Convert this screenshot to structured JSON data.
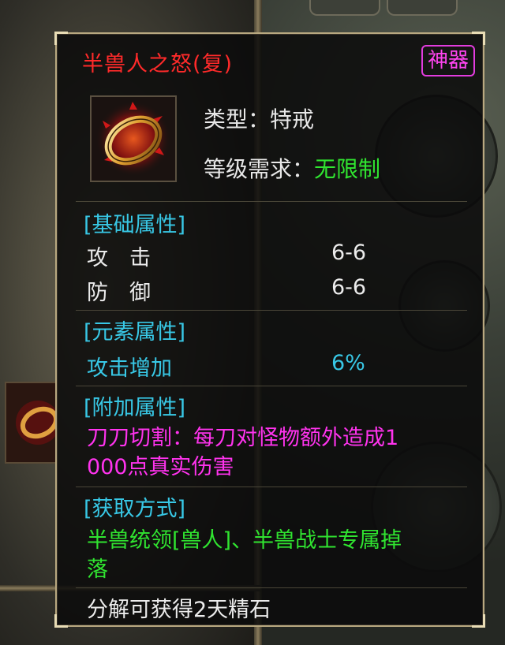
{
  "item": {
    "name": "半兽人之怒(复)",
    "badge": "神器",
    "icon": "ring-icon",
    "type_line": "类型：特戒",
    "level_label": "等级需求：",
    "level_value": "无限制"
  },
  "sections": {
    "basic": {
      "title": "[基础属性]",
      "stats": [
        {
          "label": "攻　击",
          "value": "6-6"
        },
        {
          "label": "防　御",
          "value": "6-6"
        }
      ]
    },
    "element": {
      "title": "[元素属性]",
      "stats": [
        {
          "label": "攻击增加",
          "value": "6%"
        }
      ]
    },
    "extra": {
      "title": "[附加属性]",
      "text_line1": "刀刀切割：每刀对怪物额外造成1",
      "text_line2": "000点真实伤害"
    },
    "source": {
      "title": "[获取方式]",
      "text_line1": "半兽统领[兽人]、半兽战士专属掉",
      "text_line2": "落"
    }
  },
  "footer": "分解可获得2天精石",
  "colors": {
    "name": "#ff2a2a",
    "badge": "#ff44f0",
    "section": "#38c8e6",
    "green": "#30e430",
    "magenta": "#ff33ee",
    "border": "#b8a880"
  }
}
